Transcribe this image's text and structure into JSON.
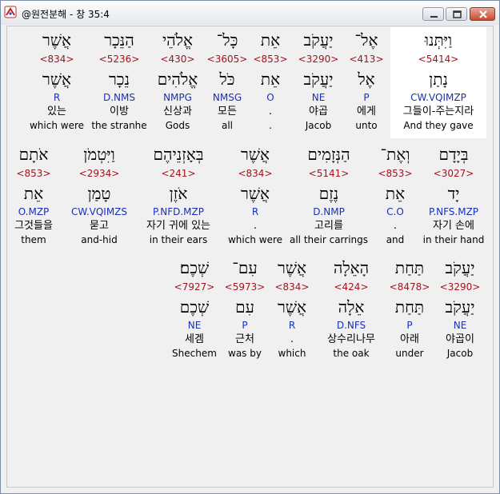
{
  "window": {
    "title": "@원전분해 - 창 35:4",
    "app_icon": "analysis-app-icon",
    "controls": [
      "minimize-icon",
      "maximize-icon",
      "close-icon"
    ]
  },
  "rows": [
    {
      "words": [
        {
          "hebrew": "וַיִּתְּנוּ",
          "strong": "<5414>",
          "lemma": "נָתַן",
          "morph": "CW.VQIMZP",
          "korean": "그들이-주는지라",
          "english": "And they gave",
          "selected": true
        },
        {
          "hebrew": "אֶל־",
          "strong": "<413>",
          "lemma": "אֶל",
          "morph": "P",
          "korean": "에게",
          "english": "unto",
          "selected": false
        },
        {
          "hebrew": "יַעֲקֹב",
          "strong": "<3290>",
          "lemma": "יַעֲקֹב",
          "morph": "NE",
          "korean": "야곱",
          "english": "Jacob",
          "selected": false
        },
        {
          "hebrew": "אֵת",
          "strong": "<853>",
          "lemma": "אֵת",
          "morph": "O",
          "korean": ".",
          "english": ".",
          "selected": false
        },
        {
          "hebrew": "כָּל־",
          "strong": "<3605>",
          "lemma": "כֹּל",
          "morph": "NMSG",
          "korean": "모든",
          "english": "all",
          "selected": false
        },
        {
          "hebrew": "אֱלֹהֵי",
          "strong": "<430>",
          "lemma": "אֱלֹהִים",
          "morph": "NMPG",
          "korean": "신상과",
          "english": "Gods",
          "selected": false
        },
        {
          "hebrew": "הַנֵּכָר",
          "strong": "<5236>",
          "lemma": "נֵכָר",
          "morph": "D.NMS",
          "korean": "이방",
          "english": "the stranhe",
          "selected": false
        },
        {
          "hebrew": "אֲשֶׁר",
          "strong": "<834>",
          "lemma": "אֲשֶׁר",
          "morph": "R",
          "korean": "있는",
          "english": "which were",
          "selected": false
        }
      ]
    },
    {
      "words": [
        {
          "hebrew": "בְּיָדָם",
          "strong": "<3027>",
          "lemma": "יָד",
          "morph": "P.NFS.MZP",
          "korean": "자기 손에",
          "english": "in their hand",
          "selected": false
        },
        {
          "hebrew": "וְאֶת־",
          "strong": "<853>",
          "lemma": "אֵת",
          "morph": "C.O",
          "korean": ".",
          "english": "and",
          "selected": false
        },
        {
          "hebrew": "הַנְּזָמִים",
          "strong": "<5141>",
          "lemma": "נֶזֶם",
          "morph": "D.NMP",
          "korean": "고리를",
          "english": "all their carrings",
          "selected": false
        },
        {
          "hebrew": "אֲשֶׁר",
          "strong": "<834>",
          "lemma": "אֲשֶׁר",
          "morph": "R",
          "korean": ".",
          "english": "which were",
          "selected": false
        },
        {
          "hebrew": "בְּאָזְנֵיהֶם",
          "strong": "<241>",
          "lemma": "אֹזֶן",
          "morph": "P.NFD.MZP",
          "korean": "자기 귀에 있는",
          "english": "in their ears",
          "selected": false
        },
        {
          "hebrew": "וַיִּטְמֹן",
          "strong": "<2934>",
          "lemma": "טָמַן",
          "morph": "CW.VQIMZS",
          "korean": "묻고",
          "english": "and-hid",
          "selected": false
        },
        {
          "hebrew": "אֹתָם",
          "strong": "<853>",
          "lemma": "אֵת",
          "morph": "O.MZP",
          "korean": "그것들을",
          "english": "them",
          "selected": false
        }
      ]
    },
    {
      "words": [
        {
          "hebrew": "יַעֲקֹב",
          "strong": "<3290>",
          "lemma": "יַעֲקֹב",
          "morph": "NE",
          "korean": "야곱이",
          "english": "Jacob",
          "selected": false
        },
        {
          "hebrew": "תַּחַת",
          "strong": "<8478>",
          "lemma": "תַּחַת",
          "morph": "P",
          "korean": "아래",
          "english": "under",
          "selected": false
        },
        {
          "hebrew": "הָאֵלָה",
          "strong": "<424>",
          "lemma": "אֵלָה",
          "morph": "D.NFS",
          "korean": "상수리나무",
          "english": "the oak",
          "selected": false
        },
        {
          "hebrew": "אֲשֶׁר",
          "strong": "<834>",
          "lemma": "אֲשֶׁר",
          "morph": "R",
          "korean": ".",
          "english": "which",
          "selected": false
        },
        {
          "hebrew": "עִם־",
          "strong": "<5973>",
          "lemma": "עִם",
          "morph": "P",
          "korean": "근처",
          "english": "was by",
          "selected": false
        },
        {
          "hebrew": "שְׁכֶם׃",
          "strong": "<7927>",
          "lemma": "שְׁכֶם",
          "morph": "NE",
          "korean": "세겜",
          "english": "Shechem",
          "selected": false
        }
      ]
    }
  ]
}
